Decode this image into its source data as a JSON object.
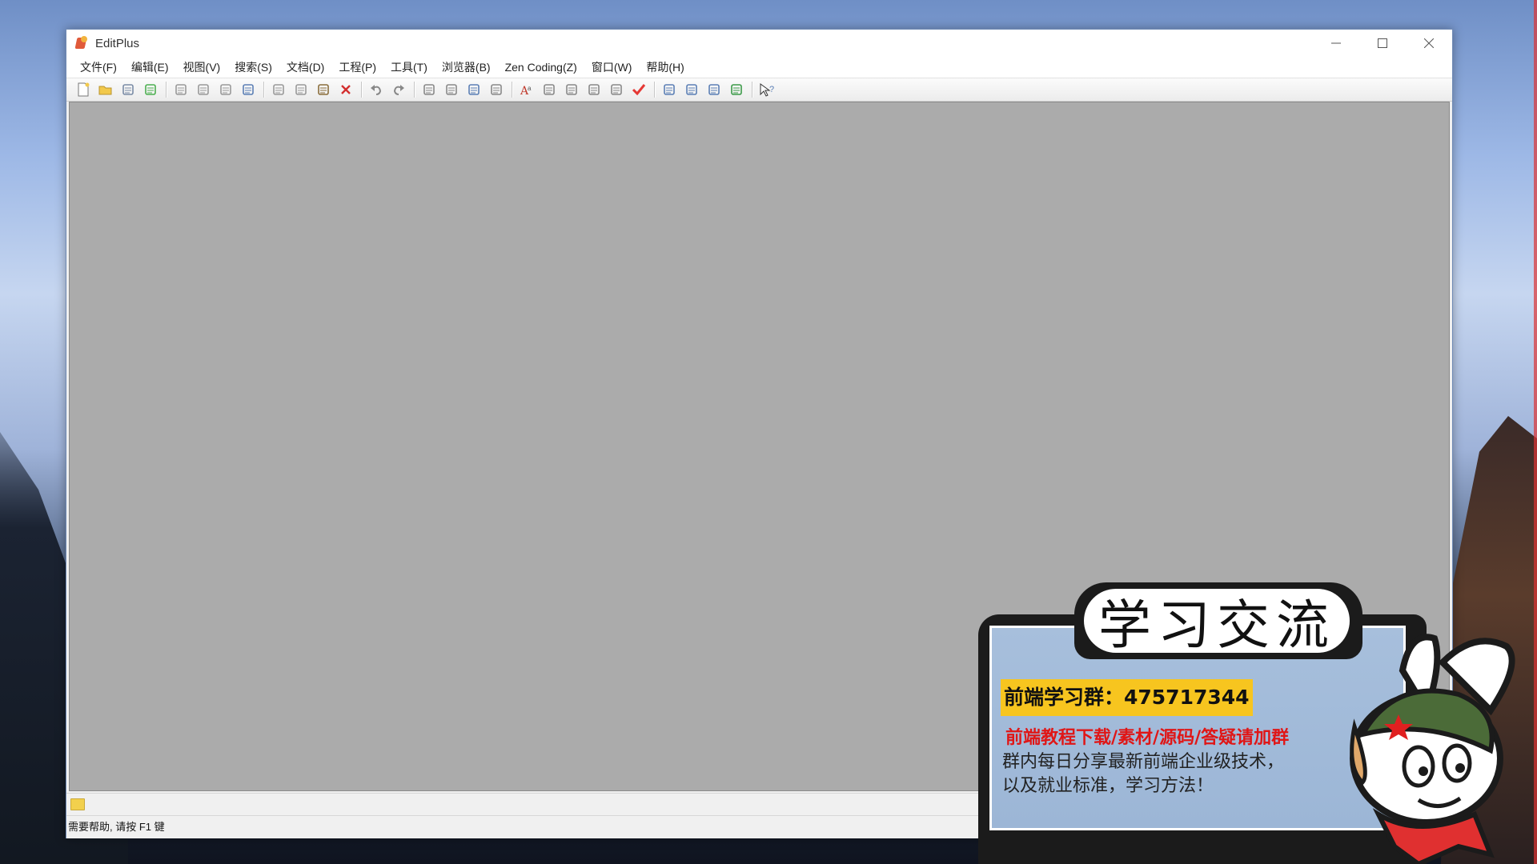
{
  "window": {
    "title": "EditPlus",
    "controls": [
      "minimize-icon",
      "maximize-icon",
      "close-icon"
    ]
  },
  "menu": [
    {
      "label": "文件(F)"
    },
    {
      "label": "编辑(E)"
    },
    {
      "label": "视图(V)"
    },
    {
      "label": "搜索(S)"
    },
    {
      "label": "文档(D)"
    },
    {
      "label": "工程(P)"
    },
    {
      "label": "工具(T)"
    },
    {
      "label": "浏览器(B)"
    },
    {
      "label": "Zen Coding(Z)"
    },
    {
      "label": "窗口(W)"
    },
    {
      "label": "帮助(H)"
    }
  ],
  "toolbar": {
    "icons": [
      "new-file-icon",
      "open-folder-icon",
      "save-icon",
      "save-all-icon",
      "sep",
      "print-preview-icon",
      "print-icon",
      "spell-check-icon",
      "html-preview-icon",
      "sep",
      "cut-icon",
      "copy-icon",
      "paste-icon",
      "delete-icon",
      "sep",
      "undo-icon",
      "redo-icon",
      "sep",
      "find-icon",
      "replace-icon",
      "find-in-files-icon",
      "goto-line-icon",
      "sep",
      "font-icon",
      "hex-icon",
      "ruler-icon",
      "word-wrap-icon",
      "line-number-icon",
      "check-icon",
      "sep",
      "view-dir-icon",
      "view-cliptext-icon",
      "view-output-icon",
      "view-browser-icon",
      "sep",
      "help-pointer-icon"
    ]
  },
  "statusbar": {
    "text": "需要帮助, 请按 F1 键"
  },
  "ad": {
    "heading": "学习交流",
    "group": "前端学习群：475717344",
    "line2": "前端教程下载/素材/源码/答疑请加群",
    "line3a": "群内每日分享最新前端企业级技术，",
    "line3b": "以及就业标准，学习方法！"
  },
  "colors": {
    "workspace": "#ababab",
    "accent_yellow": "#f7c51f",
    "ad_red": "#e01616"
  }
}
